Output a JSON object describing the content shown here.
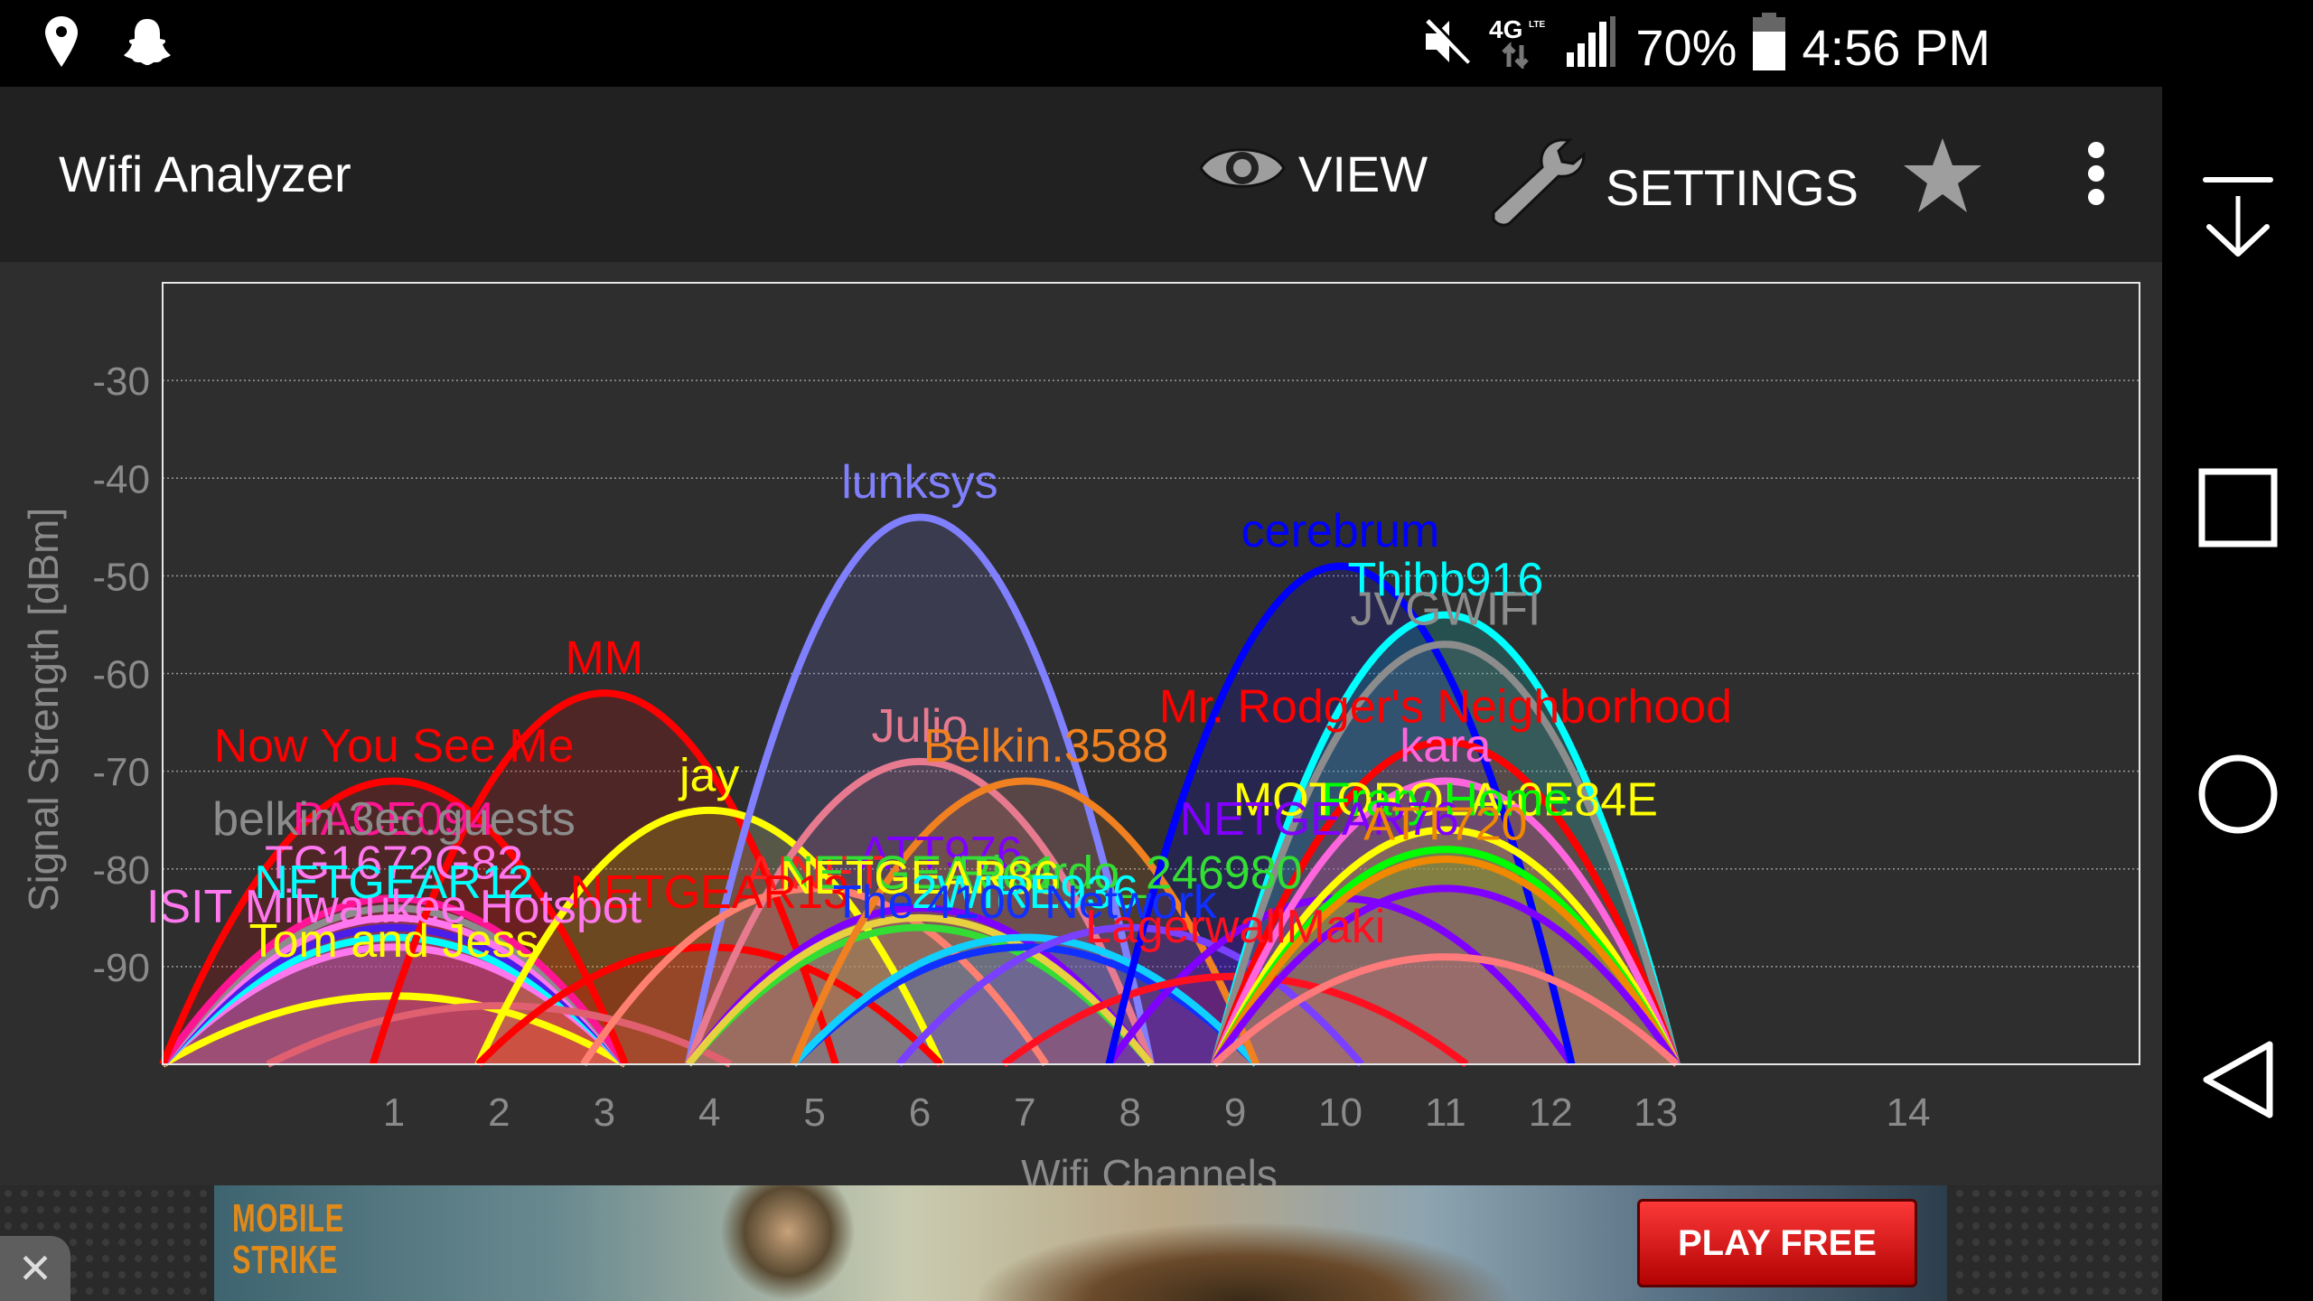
{
  "status_bar": {
    "left_icons": [
      "location-pin-icon",
      "snapchat-ghost-icon"
    ],
    "right_icons": [
      "mute-icon",
      "4g-lte-icon",
      "signal-bars-icon",
      "battery-icon"
    ],
    "network": "4G LTE",
    "battery_percent": "70%",
    "time": "4:56 PM"
  },
  "toolbar": {
    "title": "Wifi Analyzer",
    "view_label": "VIEW",
    "settings_label": "SETTINGS",
    "favorite_icon": "star-icon",
    "overflow_icon": "more-vert-icon"
  },
  "nav_bar": {
    "buttons": [
      "notification-pull-down",
      "recents",
      "home",
      "back"
    ]
  },
  "ad": {
    "logo_line1": "MOBILE",
    "logo_line2": "STRIKE",
    "cta": "PLAY FREE",
    "close_label": "✕"
  },
  "colors": {
    "background": "#2e2e2e",
    "toolbar": "#212121",
    "statusbar": "#000000",
    "grid": "#9a9a9a",
    "axis_text": "#8a8a8a"
  },
  "chart_data": {
    "type": "area",
    "title": "",
    "xlabel": "Wifi Channels",
    "ylabel": "Signal Strength [dBm]",
    "ylim": [
      -100,
      -20
    ],
    "xlim_mhz": [
      2401,
      2495
    ],
    "yticks": [
      -30,
      -40,
      -50,
      -60,
      -70,
      -80,
      -90
    ],
    "xticks": [
      {
        "label": "1",
        "mhz": 2412
      },
      {
        "label": "2",
        "mhz": 2417
      },
      {
        "label": "3",
        "mhz": 2422
      },
      {
        "label": "4",
        "mhz": 2427
      },
      {
        "label": "5",
        "mhz": 2432
      },
      {
        "label": "6",
        "mhz": 2437
      },
      {
        "label": "7",
        "mhz": 2442
      },
      {
        "label": "8",
        "mhz": 2447
      },
      {
        "label": "9",
        "mhz": 2452
      },
      {
        "label": "10",
        "mhz": 2457
      },
      {
        "label": "11",
        "mhz": 2462
      },
      {
        "label": "12",
        "mhz": 2467
      },
      {
        "label": "13",
        "mhz": 2472
      },
      {
        "label": "14",
        "mhz": 2484
      }
    ],
    "grid": true,
    "channel_width_mhz": 22,
    "series": [
      {
        "name": "Tom and Jess",
        "channel": 1,
        "dbm": -93,
        "color": "#ffff00"
      },
      {
        "name": "ISIT Milwaukee Hotspot",
        "channel": 1,
        "dbm": -88,
        "color": "#ff77ee"
      },
      {
        "name": "NETGEAR12",
        "channel": 1,
        "dbm": -87,
        "color": "#00ffff"
      },
      {
        "name": "",
        "channel": 1,
        "dbm": -86,
        "color": "#4a1ee8"
      },
      {
        "name": "TG1672G82",
        "channel": 1,
        "dbm": -85,
        "color": "#ff77ee"
      },
      {
        "name": "belkin.3ec.guests",
        "channel": 1,
        "dbm": -84,
        "color": "#8c8c8c"
      },
      {
        "name": "PACE094",
        "channel": 1,
        "dbm": -83,
        "color": "#ff1493"
      },
      {
        "name": "Now You See Me",
        "channel": 1,
        "dbm": -71,
        "color": "#ff0000"
      },
      {
        "name": "",
        "channel": 2,
        "dbm": -94,
        "color": "#e06070"
      },
      {
        "name": "MM",
        "channel": 3,
        "dbm": -62,
        "color": "#ff0000"
      },
      {
        "name": "jay",
        "channel": 4,
        "dbm": -74,
        "color": "#ffff00"
      },
      {
        "name": "NETGEAR13",
        "channel": 4,
        "dbm": -88,
        "color": "#ff0000"
      },
      {
        "name": "lunksys",
        "channel": 6,
        "dbm": -44,
        "color": "#8080ff"
      },
      {
        "name": "Julio",
        "channel": 6,
        "dbm": -69,
        "color": "#e87a90"
      },
      {
        "name": "AINET",
        "channel": 5,
        "dbm": -82,
        "color": "#ff8070"
      },
      {
        "name": "NETGEAR61",
        "channel": 6,
        "dbm": -86,
        "color": "#33dd33"
      },
      {
        "name": "ATT976",
        "channel": 6,
        "dbm": -84,
        "color": "#8000ff"
      },
      {
        "name": "NETGEAR86",
        "channel": 6,
        "dbm": -85,
        "color": "#e8d040"
      },
      {
        "name": "The 4100 Network",
        "channel": 7,
        "dbm": -88,
        "color": "#1030ff"
      },
      {
        "name": "2WIRE936",
        "channel": 7,
        "dbm": -87,
        "color": "#10d0ff"
      },
      {
        "name": "Belkin.3588",
        "channel": 7,
        "dbm": -71,
        "color": "#f08020"
      },
      {
        "name": "Ricardo_246980",
        "channel": 8,
        "dbm": -86,
        "color": "#7a40ff"
      },
      {
        "name": "NETGEAR76",
        "channel": 10,
        "dbm": -83,
        "color": "#8000ff"
      },
      {
        "name": "LagerwallMaki",
        "channel": 9,
        "dbm": -91,
        "color": "#ff1020"
      },
      {
        "name": "cerebrum",
        "channel": 10,
        "dbm": -49,
        "color": "#0000ff"
      },
      {
        "name": "Thibb916",
        "channel": 11,
        "dbm": -54,
        "color": "#00ffff"
      },
      {
        "name": "JVGWIFI",
        "channel": 11,
        "dbm": -57,
        "color": "#8c8c8c"
      },
      {
        "name": "Mr. Rodger's Neighborhood",
        "channel": 11,
        "dbm": -67,
        "color": "#ff0000"
      },
      {
        "name": "kara",
        "channel": 11,
        "dbm": -71,
        "color": "#ff66dd"
      },
      {
        "name": "MOTOROLA-0E84E",
        "channel": 11,
        "dbm": -76,
        "color": "#ffff00"
      },
      {
        "name": "Frary Home",
        "channel": 11,
        "dbm": -78,
        "color": "#00ff00"
      },
      {
        "name": "ATT720",
        "channel": 11,
        "dbm": -79,
        "color": "#f08800"
      },
      {
        "name": "",
        "channel": 11,
        "dbm": -82,
        "color": "#8000ff"
      },
      {
        "name": "",
        "channel": 11,
        "dbm": -89,
        "color": "#ff7a7a"
      }
    ],
    "labels": [
      {
        "text": "lunksys",
        "channel": 6,
        "dbm": -42,
        "color": "#8080ff"
      },
      {
        "text": "cerebrum",
        "channel": 10,
        "dbm": -47,
        "color": "#0000ff"
      },
      {
        "text": "Thibb916",
        "channel": 11,
        "dbm": -52,
        "color": "#00ffff"
      },
      {
        "text": "JVGWIFI",
        "channel": 11,
        "dbm": -55,
        "color": "#8c8c8c"
      },
      {
        "text": "MM",
        "channel": 3,
        "dbm": -60,
        "color": "#ff0000"
      },
      {
        "text": "Mr. Rodger's Neighborhood",
        "channel": 11,
        "dbm": -65,
        "color": "#ff0000"
      },
      {
        "text": "Julio",
        "channel": 6,
        "dbm": -67,
        "color": "#e87a90"
      },
      {
        "text": "Belkin.3588",
        "channel": 7.2,
        "dbm": -69,
        "color": "#f08020"
      },
      {
        "text": "Now You See Me",
        "channel": 1,
        "dbm": -69,
        "color": "#ff0000"
      },
      {
        "text": "kara",
        "channel": 11,
        "dbm": -69,
        "color": "#ff66dd"
      },
      {
        "text": "jay",
        "channel": 4,
        "dbm": -72,
        "color": "#ffff00"
      },
      {
        "text": "MOTOROLA-0E84E",
        "channel": 11,
        "dbm": -74.5,
        "color": "#ffff00"
      },
      {
        "text": "Frary Home",
        "channel": 11,
        "dbm": -74.5,
        "color": "#00ff00"
      },
      {
        "text": "PACE094",
        "channel": 1,
        "dbm": -76.5,
        "color": "#ff1493"
      },
      {
        "text": "NETGEAR76",
        "channel": 9.8,
        "dbm": -76.5,
        "color": "#8000ff"
      },
      {
        "text": "belkin.3ec.guests",
        "channel": 1,
        "dbm": -76.5,
        "color": "#8c8c8c"
      },
      {
        "text": "ATT720",
        "channel": 11,
        "dbm": -77,
        "color": "#f08800"
      },
      {
        "text": "ATT976",
        "channel": 6.2,
        "dbm": -80,
        "color": "#8000ff"
      },
      {
        "text": "TG1672G82",
        "channel": 1,
        "dbm": -81,
        "color": "#ff77ee"
      },
      {
        "text": "AINET",
        "channel": 5,
        "dbm": -82,
        "color": "#ff2020"
      },
      {
        "text": "NETGEAR61",
        "channel": 6,
        "dbm": -82,
        "color": "#33dd33"
      },
      {
        "text": "Ricardo_246980",
        "channel": 8,
        "dbm": -82,
        "color": "#33dd33"
      },
      {
        "text": "NETGEAR86",
        "channel": 6,
        "dbm": -82.5,
        "color": "#ffff00"
      },
      {
        "text": "NETGEAR12",
        "channel": 1,
        "dbm": -83,
        "color": "#00ffff"
      },
      {
        "text": "NETGEAR13",
        "channel": 4,
        "dbm": -84,
        "color": "#ff0000"
      },
      {
        "text": "2WIRE936",
        "channel": 7,
        "dbm": -84,
        "color": "#00ffff"
      },
      {
        "text": "The 4100 Network",
        "channel": 7,
        "dbm": -85,
        "color": "#1030ff"
      },
      {
        "text": "ISIT Milwaukee Hotspot",
        "channel": 1,
        "dbm": -85.5,
        "color": "#ff77ee"
      },
      {
        "text": "LagerwallMaki",
        "channel": 9,
        "dbm": -87.5,
        "color": "#ff1020"
      },
      {
        "text": "Tom and Jess",
        "channel": 1,
        "dbm": -89,
        "color": "#ffff00"
      }
    ]
  }
}
